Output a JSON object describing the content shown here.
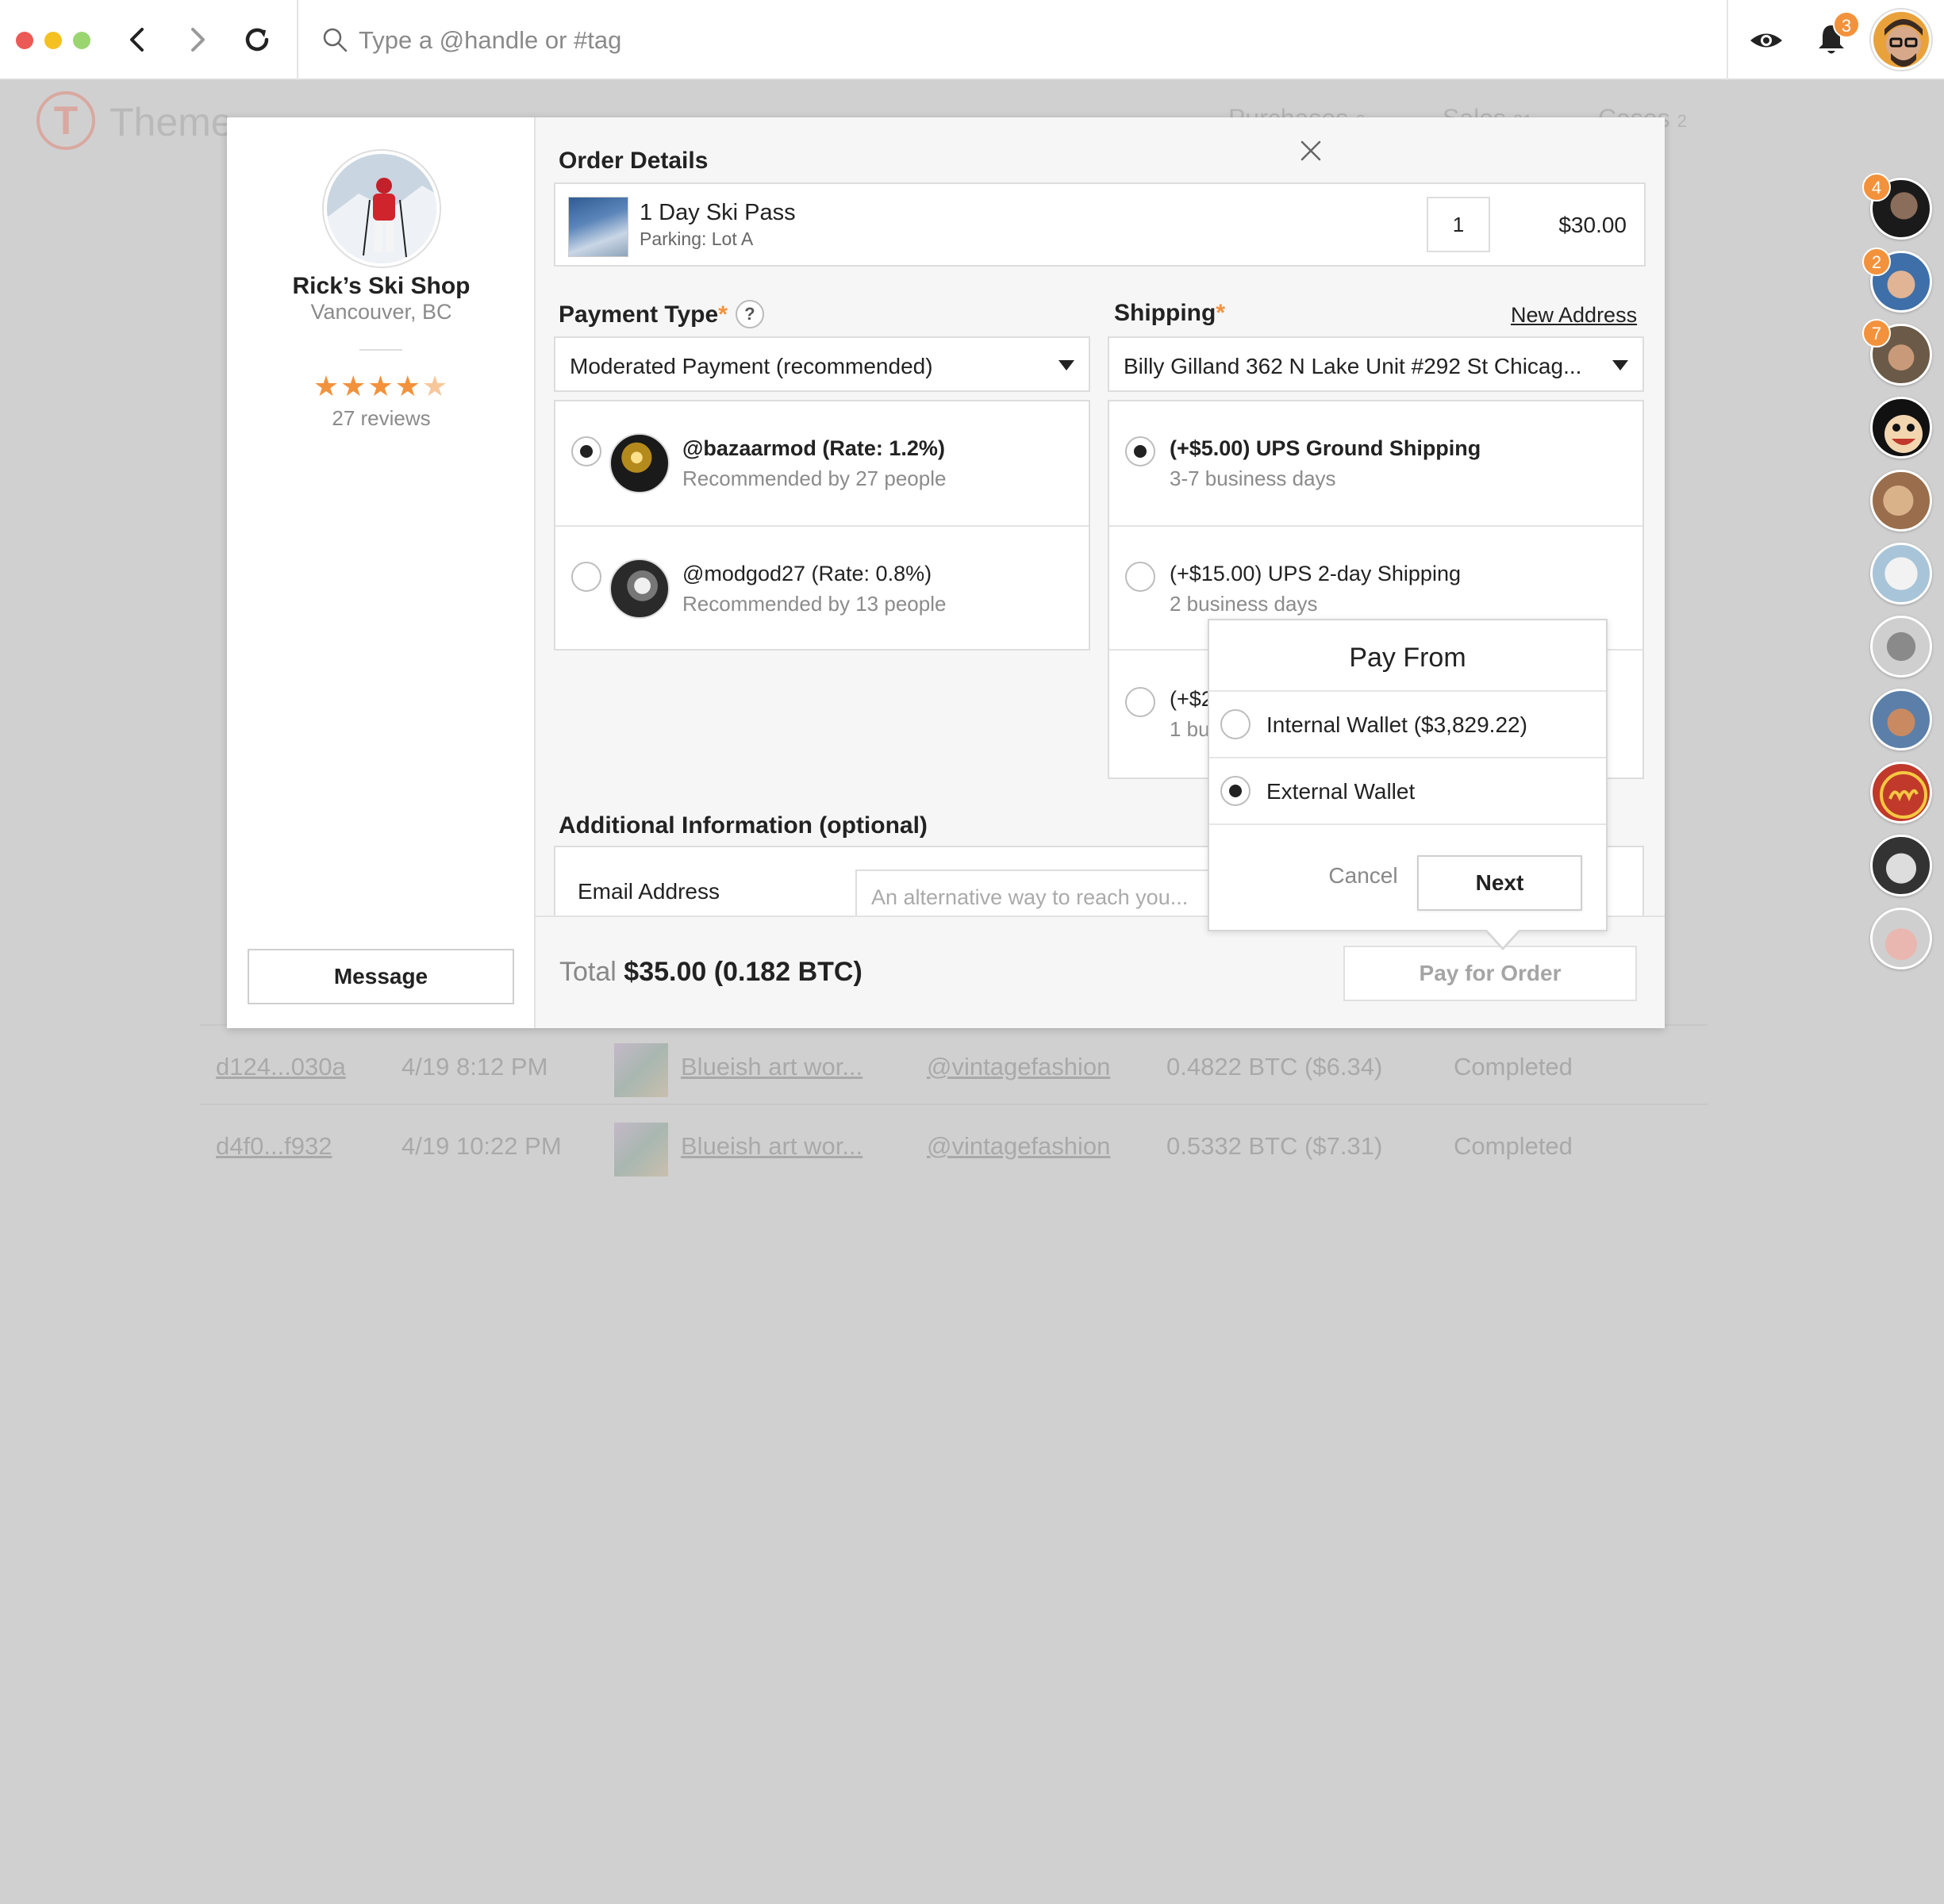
{
  "browser": {
    "search_placeholder": "Type a @handle or #tag",
    "notifications_count": "3",
    "colors": {
      "close": "#ec5a55",
      "minimize": "#f5c022",
      "maximize": "#9ad56f",
      "accent": "#f3923c"
    }
  },
  "background_page": {
    "brand": "Theme",
    "logo_letter": "T",
    "tabs": [
      {
        "label": "Purchases",
        "count": "6"
      },
      {
        "label": "Sales",
        "count": "21"
      },
      {
        "label": "Cases",
        "count": "2"
      }
    ],
    "rows": [
      {
        "id": "d124...030a",
        "date": "4/19 8:12 PM",
        "item": "Blueish art wor...",
        "store": "@vintagefashion",
        "amount": "0.4822 BTC ($6.34)",
        "status": "Completed"
      },
      {
        "id": "d4f0...f932",
        "date": "4/19 10:22 PM",
        "item": "Blueish art wor...",
        "store": "@vintagefashion",
        "amount": "0.5332 BTC ($7.31)",
        "status": "Completed"
      }
    ]
  },
  "rail": {
    "badges": [
      "4",
      "2",
      "7"
    ],
    "avatar_icons": [
      "friend-1-avatar",
      "friend-2-avatar",
      "friend-3-avatar",
      "friend-4-avatar",
      "friend-5-avatar",
      "friend-6-avatar",
      "friend-7-avatar",
      "friend-8-avatar",
      "friend-9-avatar",
      "friend-10-avatar",
      "friend-11-avatar"
    ]
  },
  "shop": {
    "name": "Rick’s Ski Shop",
    "location": "Vancouver, BC",
    "rating": 4.5,
    "stars_full": "★★★★",
    "stars_half": "★",
    "reviews": "27 reviews",
    "message_label": "Message"
  },
  "order": {
    "title": "Order Details",
    "item_name": "1 Day Ski Pass",
    "item_sub": "Parking: Lot A",
    "quantity": "1",
    "price": "$30.00"
  },
  "payment": {
    "label": "Payment Type",
    "required_mark": "*",
    "help": "?",
    "selected": "Moderated Payment (recommended)",
    "moderators": [
      {
        "handle": "@bazaarmod",
        "rate": "(Rate: 1.2%)",
        "recommended": "Recommended by 27 people",
        "selected": true
      },
      {
        "handle": "@modgod27",
        "rate": "(Rate: 0.8%)",
        "recommended": "Recommended by 13 people",
        "selected": false
      }
    ]
  },
  "shipping": {
    "label": "Shipping",
    "required_mark": "*",
    "new_address": "New Address",
    "address": "Billy Gilland 362 N Lake Unit #292 St Chicag...",
    "options": [
      {
        "title": "(+$5.00) UPS Ground Shipping",
        "sub": "3-7 business days",
        "selected": true
      },
      {
        "title": "(+$15.00) UPS 2-day Shipping",
        "sub": "2 business days",
        "selected": false
      },
      {
        "title": "(+$2",
        "sub": "1 bu",
        "selected": false
      }
    ]
  },
  "additional": {
    "title": "Additional Information (optional)",
    "email_label": "Email Address",
    "email_placeholder": "An alternative way to reach you..."
  },
  "footer": {
    "total_label": "Total",
    "total_amount": "$35.00 (0.182 BTC)",
    "pay_button": "Pay for Order"
  },
  "pay_from": {
    "title": "Pay From",
    "options": [
      {
        "label": "Internal Wallet ($3,829.22)",
        "selected": false
      },
      {
        "label": "External Wallet",
        "selected": true
      }
    ],
    "cancel": "Cancel",
    "next": "Next"
  }
}
